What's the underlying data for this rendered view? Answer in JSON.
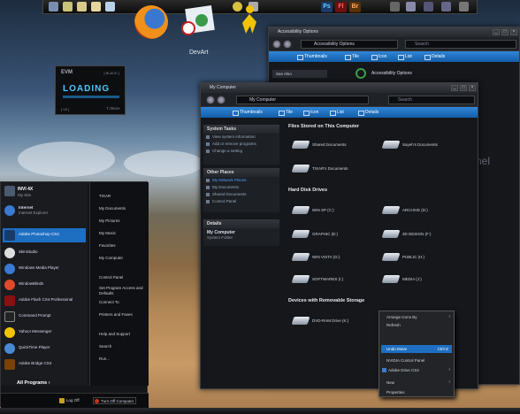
{
  "desktop": {
    "devart_label": "DevArt"
  },
  "dock": {
    "app_labels": [
      "Ps",
      "Fl",
      "Br"
    ]
  },
  "loading_widget": {
    "brand": "EVM",
    "tag": "[ BLACK ]",
    "text": "LOADING",
    "version": "[ V5 ]",
    "footer": "T-TECH"
  },
  "accessibility_window": {
    "title": "Accessibility Options",
    "address": "Accessibility Options",
    "search_placeholder": "Search",
    "toolbar": [
      "Thumbnails",
      "Tile",
      "Icon",
      "List",
      "Details"
    ],
    "see_also": "See Also",
    "heading": "Accessibility Options"
  },
  "computer_window": {
    "title": "My Computer",
    "address": "My Computer",
    "search_placeholder": "Search",
    "toolbar": [
      "Thumbnails",
      "Tile",
      "Icon",
      "List",
      "Details"
    ],
    "system_tasks": {
      "header": "System Tasks",
      "items": [
        "View system information",
        "Add or remove programs",
        "Change a setting"
      ]
    },
    "other_places": {
      "header": "Other Places",
      "items": [
        "My Network Places",
        "My Documents",
        "Shared Documents",
        "Control Panel"
      ]
    },
    "details": {
      "header": "Details",
      "name": "My Computer",
      "type": "System Folder"
    },
    "files_section": "Files Stored on This Computer",
    "files": [
      "Shared Documents",
      "Sayeh's Documents",
      "TIXAR's Documents"
    ],
    "drives_section": "Hard Disk Drives",
    "drives": [
      "WIN XP (C:)",
      "ARCHIVE (D:)",
      "GRAPHIC (E:)",
      "3D DESIGN (F:)",
      "WIN VISTA (G:)",
      "PUBLIC (H:)",
      "SOFTWARES (I:)",
      "MEDIA (J:)"
    ],
    "removable_section": "Devices with Removable Storage",
    "removable": [
      "DVD-RAM Drive (K:)"
    ]
  },
  "context_menu": {
    "items": [
      {
        "label": "Arrange Icons By",
        "arrow": "›"
      },
      {
        "label": "Refresh"
      },
      {
        "label": "Undo Move",
        "shortcut": "Ctrl+Z"
      },
      {
        "label": "NVIDIA Control Panel"
      },
      {
        "label": "Adobe Drive CS4",
        "arrow": "›"
      },
      {
        "label": "New",
        "arrow": "›"
      },
      {
        "label": "Properties"
      }
    ]
  },
  "start_menu": {
    "user": "INVI 4X",
    "user_sub": "My skin",
    "pinned": [
      {
        "label": "Internet",
        "sub": "Internet Explorer"
      },
      {
        "label": "Adobe Photoshop CS4"
      },
      {
        "label": "SkinStudio"
      },
      {
        "label": "Windows Media Player"
      },
      {
        "label": "WindowBlinds"
      },
      {
        "label": "Adobe Flash CS4 Professional"
      },
      {
        "label": "Command Prompt"
      },
      {
        "label": "Yahoo! Messenger"
      },
      {
        "label": "QuickTime Player"
      },
      {
        "label": "Adobe Bridge CS4"
      }
    ],
    "all_programs": "All Programs",
    "right_items": [
      "TIXAR",
      "My Documents",
      "My Pictures",
      "My Music",
      "Favorites",
      "My Computer",
      "Control Panel",
      "Set Program Access and Defaults",
      "Connect To",
      "Printers and Faxes",
      "Help and Support",
      "Search",
      "Run..."
    ],
    "log_off": "Log Off",
    "turn_off": "Turn Off Computer"
  },
  "colors": {
    "accent": "#1e73c8",
    "panel": "#15171b"
  }
}
